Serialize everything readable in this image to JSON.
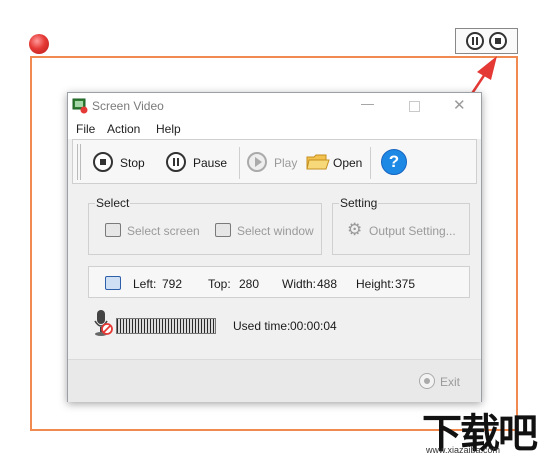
{
  "window": {
    "title": "Screen Video"
  },
  "menu": [
    "File",
    "Action",
    "Help"
  ],
  "toolbar": {
    "stop_label": "Stop",
    "pause_label": "Pause",
    "play_label": "Play",
    "open_label": "Open"
  },
  "select_group": {
    "title": "Select",
    "select_screen": "Select screen",
    "select_window": "Select window"
  },
  "setting_group": {
    "title": "Setting",
    "output_setting": "Output Setting..."
  },
  "region": {
    "left_label": "Left:",
    "left": "792",
    "top_label": "Top:",
    "top": "280",
    "width_label": "Width:",
    "width": "488",
    "height_label": "Height:",
    "height": "375"
  },
  "status": {
    "used_time_label": "Used time:",
    "used_time": "00:00:04"
  },
  "footer": {
    "exit_label": "Exit"
  },
  "watermark": {
    "logo": "下载吧",
    "url": "www.xiazaiba.com"
  },
  "colors": {
    "capture_border": "#f08a50",
    "arrow": "#e53935",
    "help_blue": "#1e88e5"
  },
  "icons": [
    "record-indicator-icon",
    "pause-icon",
    "stop-icon",
    "play-icon",
    "folder-icon",
    "help-icon",
    "monitor-icon",
    "window-icon",
    "gear-icon",
    "microphone-muted-icon",
    "exit-icon"
  ]
}
